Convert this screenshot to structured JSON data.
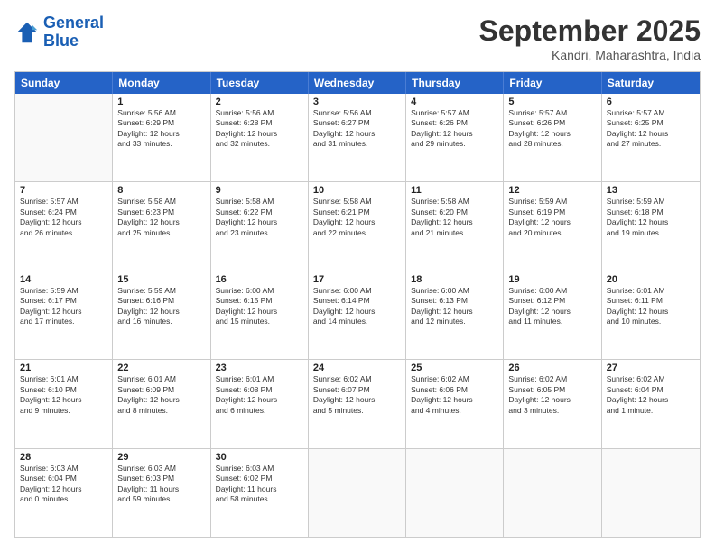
{
  "logo": {
    "line1": "General",
    "line2": "Blue"
  },
  "header": {
    "month": "September 2025",
    "location": "Kandri, Maharashtra, India"
  },
  "weekdays": [
    "Sunday",
    "Monday",
    "Tuesday",
    "Wednesday",
    "Thursday",
    "Friday",
    "Saturday"
  ],
  "rows": [
    [
      {
        "day": "",
        "info": ""
      },
      {
        "day": "1",
        "info": "Sunrise: 5:56 AM\nSunset: 6:29 PM\nDaylight: 12 hours\nand 33 minutes."
      },
      {
        "day": "2",
        "info": "Sunrise: 5:56 AM\nSunset: 6:28 PM\nDaylight: 12 hours\nand 32 minutes."
      },
      {
        "day": "3",
        "info": "Sunrise: 5:56 AM\nSunset: 6:27 PM\nDaylight: 12 hours\nand 31 minutes."
      },
      {
        "day": "4",
        "info": "Sunrise: 5:57 AM\nSunset: 6:26 PM\nDaylight: 12 hours\nand 29 minutes."
      },
      {
        "day": "5",
        "info": "Sunrise: 5:57 AM\nSunset: 6:26 PM\nDaylight: 12 hours\nand 28 minutes."
      },
      {
        "day": "6",
        "info": "Sunrise: 5:57 AM\nSunset: 6:25 PM\nDaylight: 12 hours\nand 27 minutes."
      }
    ],
    [
      {
        "day": "7",
        "info": "Sunrise: 5:57 AM\nSunset: 6:24 PM\nDaylight: 12 hours\nand 26 minutes."
      },
      {
        "day": "8",
        "info": "Sunrise: 5:58 AM\nSunset: 6:23 PM\nDaylight: 12 hours\nand 25 minutes."
      },
      {
        "day": "9",
        "info": "Sunrise: 5:58 AM\nSunset: 6:22 PM\nDaylight: 12 hours\nand 23 minutes."
      },
      {
        "day": "10",
        "info": "Sunrise: 5:58 AM\nSunset: 6:21 PM\nDaylight: 12 hours\nand 22 minutes."
      },
      {
        "day": "11",
        "info": "Sunrise: 5:58 AM\nSunset: 6:20 PM\nDaylight: 12 hours\nand 21 minutes."
      },
      {
        "day": "12",
        "info": "Sunrise: 5:59 AM\nSunset: 6:19 PM\nDaylight: 12 hours\nand 20 minutes."
      },
      {
        "day": "13",
        "info": "Sunrise: 5:59 AM\nSunset: 6:18 PM\nDaylight: 12 hours\nand 19 minutes."
      }
    ],
    [
      {
        "day": "14",
        "info": "Sunrise: 5:59 AM\nSunset: 6:17 PM\nDaylight: 12 hours\nand 17 minutes."
      },
      {
        "day": "15",
        "info": "Sunrise: 5:59 AM\nSunset: 6:16 PM\nDaylight: 12 hours\nand 16 minutes."
      },
      {
        "day": "16",
        "info": "Sunrise: 6:00 AM\nSunset: 6:15 PM\nDaylight: 12 hours\nand 15 minutes."
      },
      {
        "day": "17",
        "info": "Sunrise: 6:00 AM\nSunset: 6:14 PM\nDaylight: 12 hours\nand 14 minutes."
      },
      {
        "day": "18",
        "info": "Sunrise: 6:00 AM\nSunset: 6:13 PM\nDaylight: 12 hours\nand 12 minutes."
      },
      {
        "day": "19",
        "info": "Sunrise: 6:00 AM\nSunset: 6:12 PM\nDaylight: 12 hours\nand 11 minutes."
      },
      {
        "day": "20",
        "info": "Sunrise: 6:01 AM\nSunset: 6:11 PM\nDaylight: 12 hours\nand 10 minutes."
      }
    ],
    [
      {
        "day": "21",
        "info": "Sunrise: 6:01 AM\nSunset: 6:10 PM\nDaylight: 12 hours\nand 9 minutes."
      },
      {
        "day": "22",
        "info": "Sunrise: 6:01 AM\nSunset: 6:09 PM\nDaylight: 12 hours\nand 8 minutes."
      },
      {
        "day": "23",
        "info": "Sunrise: 6:01 AM\nSunset: 6:08 PM\nDaylight: 12 hours\nand 6 minutes."
      },
      {
        "day": "24",
        "info": "Sunrise: 6:02 AM\nSunset: 6:07 PM\nDaylight: 12 hours\nand 5 minutes."
      },
      {
        "day": "25",
        "info": "Sunrise: 6:02 AM\nSunset: 6:06 PM\nDaylight: 12 hours\nand 4 minutes."
      },
      {
        "day": "26",
        "info": "Sunrise: 6:02 AM\nSunset: 6:05 PM\nDaylight: 12 hours\nand 3 minutes."
      },
      {
        "day": "27",
        "info": "Sunrise: 6:02 AM\nSunset: 6:04 PM\nDaylight: 12 hours\nand 1 minute."
      }
    ],
    [
      {
        "day": "28",
        "info": "Sunrise: 6:03 AM\nSunset: 6:04 PM\nDaylight: 12 hours\nand 0 minutes."
      },
      {
        "day": "29",
        "info": "Sunrise: 6:03 AM\nSunset: 6:03 PM\nDaylight: 11 hours\nand 59 minutes."
      },
      {
        "day": "30",
        "info": "Sunrise: 6:03 AM\nSunset: 6:02 PM\nDaylight: 11 hours\nand 58 minutes."
      },
      {
        "day": "",
        "info": ""
      },
      {
        "day": "",
        "info": ""
      },
      {
        "day": "",
        "info": ""
      },
      {
        "day": "",
        "info": ""
      }
    ]
  ]
}
